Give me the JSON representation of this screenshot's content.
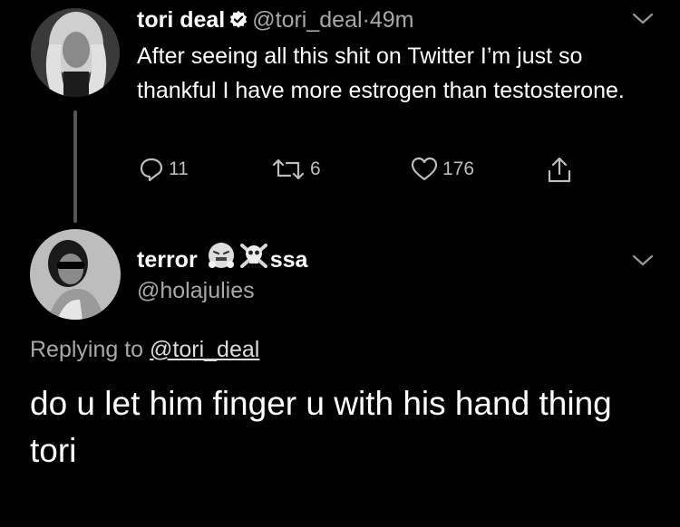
{
  "tweet1": {
    "display_name": "tori deal",
    "handle": "@tori_deal",
    "separator": "·",
    "time": "49m",
    "text": "After seeing all this shit on Twitter I’m just so thankful I have more estrogen than testosterone.",
    "actions": {
      "reply_count": "11",
      "retweet_count": "6",
      "like_count": "176"
    }
  },
  "tweet2": {
    "display_name_start": "terror",
    "display_name_end": "ssa",
    "handle": "@holajulies",
    "replying_prefix": "Replying to",
    "replying_to": "@tori_deal",
    "text": "do u let him finger u with his hand thing tori"
  },
  "icons": {
    "verified": "verified-badge-icon",
    "chevron": "chevron-down-icon",
    "reply": "reply-icon",
    "retweet": "retweet-icon",
    "like": "heart-icon",
    "share": "share-icon",
    "emoji1": "face-with-steam-emoji",
    "emoji2": "skull-crossbones-emoji"
  },
  "colors": {
    "background": "#000000",
    "text": "#ffffff",
    "muted": "#a8a8a8"
  }
}
